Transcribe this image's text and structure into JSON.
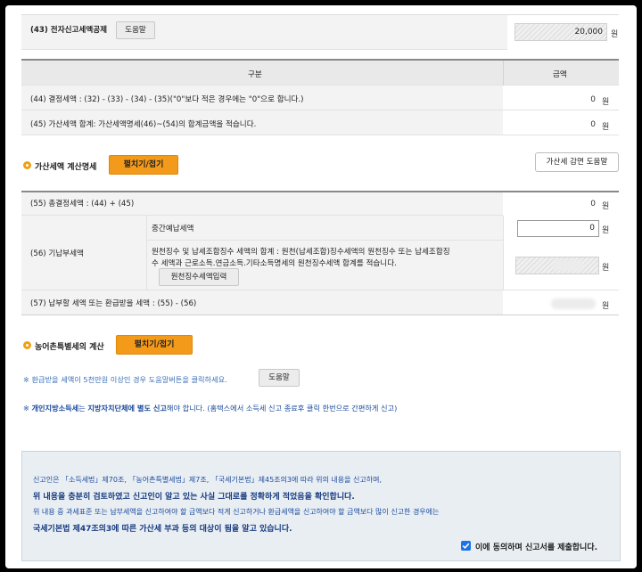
{
  "row43": {
    "label": "(43) 전자신고세액공제",
    "help": "도움말",
    "value": "20,000",
    "unit": "원"
  },
  "table_header": {
    "col1": "구분",
    "col2": "금액"
  },
  "row44": {
    "label": "(44) 결정세액 : (32) - (33) - (34) - (35)(\"0\"보다 적은 경우에는 \"0\"으로 합니다.)",
    "value": "0",
    "unit": "원"
  },
  "row45": {
    "label": "(45) 가산세액 합계: 가산세액명세(46)~(54)의 합계금액을 적습니다.",
    "value": "0",
    "unit": "원"
  },
  "penalty_section": {
    "title": "가산세액 계산명세",
    "toggle": "펼치기/접기",
    "help": "가산세 감면 도움말"
  },
  "row55": {
    "label": "(55) 총결정세액 : (44) + (45)",
    "value": "0",
    "unit": "원"
  },
  "row56": {
    "label": "(56) 기납부세액",
    "interim_label": "중간예납세액",
    "interim_value": "0",
    "unit": "원",
    "withholding_line1": "원천징수 및 납세조합징수 세액의 합계 : 원천(납세조합)징수세액의 원천징수 또는 납세조합징",
    "withholding_line2": "수 세액과 근로소득.연금소득.기타소득명세의 원천징수세액 합계를 적습니다.",
    "withholding_button": "원천징수세액입력",
    "withholding_unit": "원"
  },
  "row57": {
    "label": "(57) 납부할 세액 또는 환급받을 세액 : (55) - (56)",
    "unit": "원"
  },
  "rural_section": {
    "title": "농어촌특별세의 계산",
    "toggle": "펼치기/접기"
  },
  "refund_note": {
    "text": "※ 환급받을 세액이 5천만원 이상인 경우 도움말버튼을 클릭하세요.",
    "help": "도움말"
  },
  "local_note": {
    "prefix": "※ ",
    "bold1": "개인지방소득세",
    "mid": "는 ",
    "bold2": "지방자치단체에 별도 신고",
    "rest": "해야 합니다. (홈택스에서 소득세 신고 종료후 클릭 한번으로 간편하게 신고)"
  },
  "declaration": {
    "line1": "신고인은 「소득세법」제70조, 「농어촌특별세법」제7조, 「국세기본법」제45조의3에 따라 위의 내용을 신고하며,",
    "line2": "위 내용을 충분히 검토하였고 신고인이 알고 있는 사실 그대로를 정확하게 적었음을 확인합니다.",
    "line3": "위 내용 중 과세표준 또는 납부세액을 신고하여야 할 금액보다 적게 신고하거나 환급세액을 신고하여야 할 금액보다 많이 신고한 경우에는",
    "line4": "국세기본법 제47조의3에 따른 가산세 부과 등의 대상이 됨을 알고 있습니다.",
    "agree": "이에 동의하며 신고서를 제출합니다.",
    "agreed": true
  },
  "colors": {
    "accent": "#f39a1a",
    "note_blue": "#1a4a9c",
    "checkbox": "#1a73e8"
  }
}
